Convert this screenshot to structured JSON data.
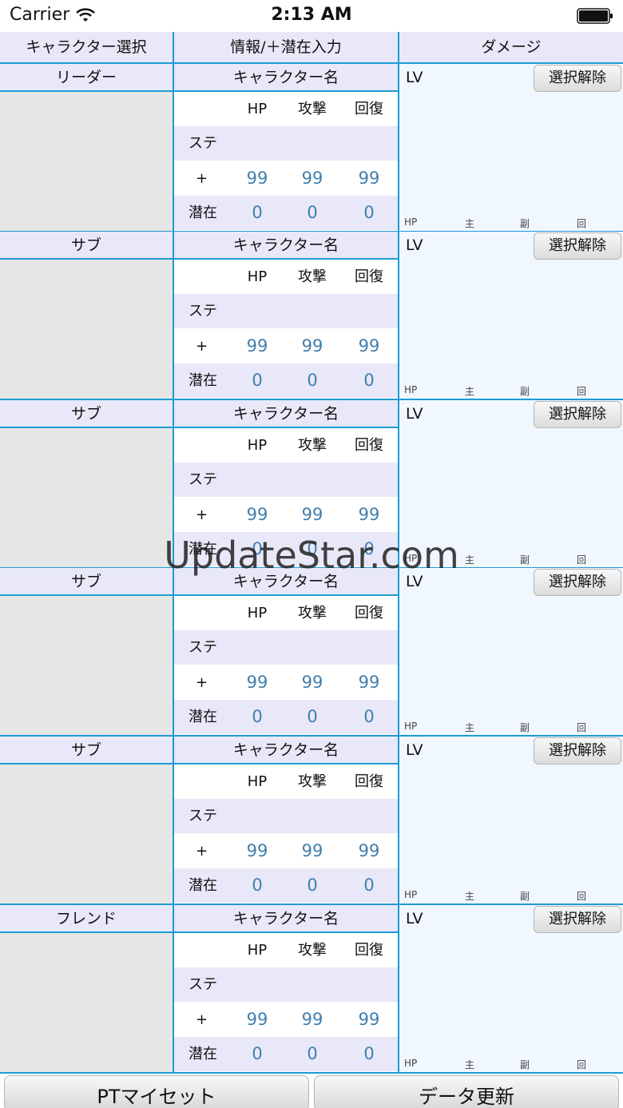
{
  "status_bar": {
    "carrier": "Carrier",
    "time": "2:13 AM"
  },
  "header": {
    "col1": "キャラクター選択",
    "col2": "情報/＋潜在入力",
    "col3": "ダメージ"
  },
  "stat_headers": [
    "HP",
    "攻撃",
    "回復"
  ],
  "stat_row_labels": {
    "base": "ステ",
    "plus": "+",
    "potential": "潜在"
  },
  "damage_labels": {
    "lv": "LV",
    "hp": "HP",
    "main": "主",
    "sub": "副",
    "heal": "回"
  },
  "deselect_label": "選択解除",
  "rows": [
    {
      "slot": "リーダー",
      "name": "キャラクター名",
      "plus": [
        "99",
        "99",
        "99"
      ],
      "potential": [
        "0",
        "0",
        "0"
      ]
    },
    {
      "slot": "サブ",
      "name": "キャラクター名",
      "plus": [
        "99",
        "99",
        "99"
      ],
      "potential": [
        "0",
        "0",
        "0"
      ]
    },
    {
      "slot": "サブ",
      "name": "キャラクター名",
      "plus": [
        "99",
        "99",
        "99"
      ],
      "potential": [
        "0",
        "0",
        "0"
      ]
    },
    {
      "slot": "サブ",
      "name": "キャラクター名",
      "plus": [
        "99",
        "99",
        "99"
      ],
      "potential": [
        "0",
        "0",
        "0"
      ]
    },
    {
      "slot": "サブ",
      "name": "キャラクター名",
      "plus": [
        "99",
        "99",
        "99"
      ],
      "potential": [
        "0",
        "0",
        "0"
      ]
    },
    {
      "slot": "フレンド",
      "name": "キャラクター名",
      "plus": [
        "99",
        "99",
        "99"
      ],
      "potential": [
        "0",
        "0",
        "0"
      ]
    }
  ],
  "bottom": {
    "left": "PTマイセット",
    "right": "データ更新"
  },
  "watermark": "UpdateStar.com",
  "colors": {
    "accent": "#1e9bd4",
    "header_bg": "#e8e8f8",
    "number": "#3f7fb0",
    "damage_bg": "#f0f7ff",
    "left_bg": "#e6e6e6"
  }
}
